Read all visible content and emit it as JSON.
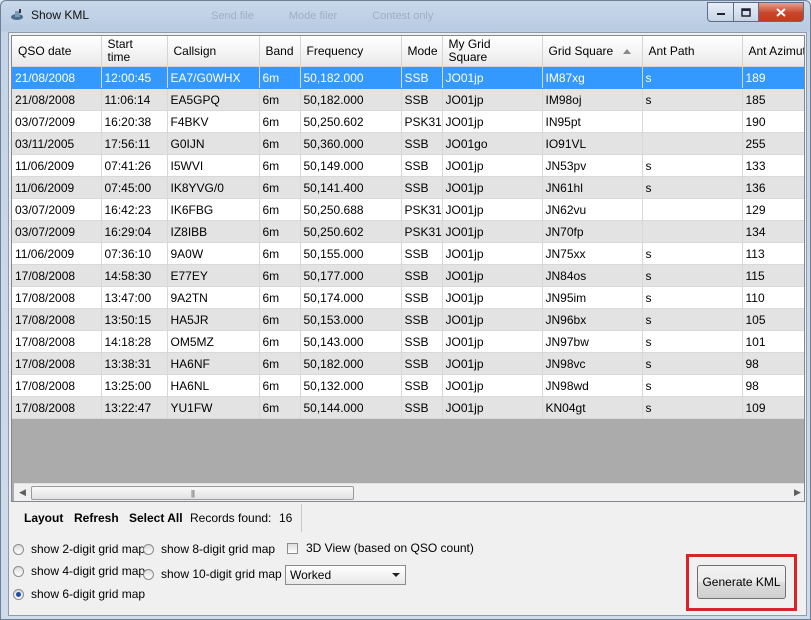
{
  "window": {
    "title": "Show KML",
    "ghost_items": [
      "Send file",
      "Mode filer",
      "Contest only"
    ]
  },
  "columns": [
    "QSO date",
    "Start time",
    "Callsign",
    "Band",
    "Frequency",
    "Mode",
    "My Grid Square",
    "Grid Square",
    "Ant Path",
    "Ant Azimuth"
  ],
  "rows": [
    [
      "21/08/2008",
      "12:00:45",
      "EA7/G0WHX",
      "6m",
      "50,182.000",
      "SSB",
      "JO01jp",
      "IM87xg",
      "s",
      "189"
    ],
    [
      "21/08/2008",
      "11:06:14",
      "EA5GPQ",
      "6m",
      "50,182.000",
      "SSB",
      "JO01jp",
      "IM98oj",
      "s",
      "185"
    ],
    [
      "03/07/2009",
      "16:20:38",
      "F4BKV",
      "6m",
      "50,250.602",
      "PSK31",
      "JO01jp",
      "IN95pt",
      "",
      "190"
    ],
    [
      "03/11/2005",
      "17:56:11",
      "G0IJN",
      "6m",
      "50,360.000",
      "SSB",
      "JO01go",
      "IO91VL",
      "",
      "255"
    ],
    [
      "11/06/2009",
      "07:41:26",
      "I5WVI",
      "6m",
      "50,149.000",
      "SSB",
      "JO01jp",
      "JN53pv",
      "s",
      "133"
    ],
    [
      "11/06/2009",
      "07:45:00",
      "IK8YVG/0",
      "6m",
      "50,141.400",
      "SSB",
      "JO01jp",
      "JN61hl",
      "s",
      "136"
    ],
    [
      "03/07/2009",
      "16:42:23",
      "IK6FBG",
      "6m",
      "50,250.688",
      "PSK31",
      "JO01jp",
      "JN62vu",
      "",
      "129"
    ],
    [
      "03/07/2009",
      "16:29:04",
      "IZ8IBB",
      "6m",
      "50,250.602",
      "PSK31",
      "JO01jp",
      "JN70fp",
      "",
      "134"
    ],
    [
      "11/06/2009",
      "07:36:10",
      "9A0W",
      "6m",
      "50,155.000",
      "SSB",
      "JO01jp",
      "JN75xx",
      "s",
      "113"
    ],
    [
      "17/08/2008",
      "14:58:30",
      "E77EY",
      "6m",
      "50,177.000",
      "SSB",
      "JO01jp",
      "JN84os",
      "s",
      "115"
    ],
    [
      "17/08/2008",
      "13:47:00",
      "9A2TN",
      "6m",
      "50,174.000",
      "SSB",
      "JO01jp",
      "JN95im",
      "s",
      "110"
    ],
    [
      "17/08/2008",
      "13:50:15",
      "HA5JR",
      "6m",
      "50,153.000",
      "SSB",
      "JO01jp",
      "JN96bx",
      "s",
      "105"
    ],
    [
      "17/08/2008",
      "14:18:28",
      "OM5MZ",
      "6m",
      "50,143.000",
      "SSB",
      "JO01jp",
      "JN97bw",
      "s",
      "101"
    ],
    [
      "17/08/2008",
      "13:38:31",
      "HA6NF",
      "6m",
      "50,182.000",
      "SSB",
      "JO01jp",
      "JN98vc",
      "s",
      "98"
    ],
    [
      "17/08/2008",
      "13:25:00",
      "HA6NL",
      "6m",
      "50,132.000",
      "SSB",
      "JO01jp",
      "JN98wd",
      "s",
      "98"
    ],
    [
      "17/08/2008",
      "13:22:47",
      "YU1FW",
      "6m",
      "50,144.000",
      "SSB",
      "JO01jp",
      "KN04gt",
      "s",
      "109"
    ]
  ],
  "selected_row": 0,
  "sorted_column": 7,
  "toolbar": {
    "layout": "Layout",
    "refresh": "Refresh",
    "select_all": "Select All",
    "records_label": "Records found:",
    "records_count": "16"
  },
  "options": {
    "radio_2": "show 2-digit grid map",
    "radio_4": "show 4-digit grid map",
    "radio_6": "show 6-digit grid map",
    "radio_8": "show 8-digit grid map",
    "radio_10": "show 10-digit grid map",
    "selected_radio": "radio_6",
    "view3d": "3D View (based on QSO count)",
    "dropdown_value": "Worked",
    "generate": "Generate KML"
  },
  "scrollbar_grip": "|||",
  "colors": {
    "selection": "#3399ff",
    "highlight_border": "#d8232a"
  }
}
